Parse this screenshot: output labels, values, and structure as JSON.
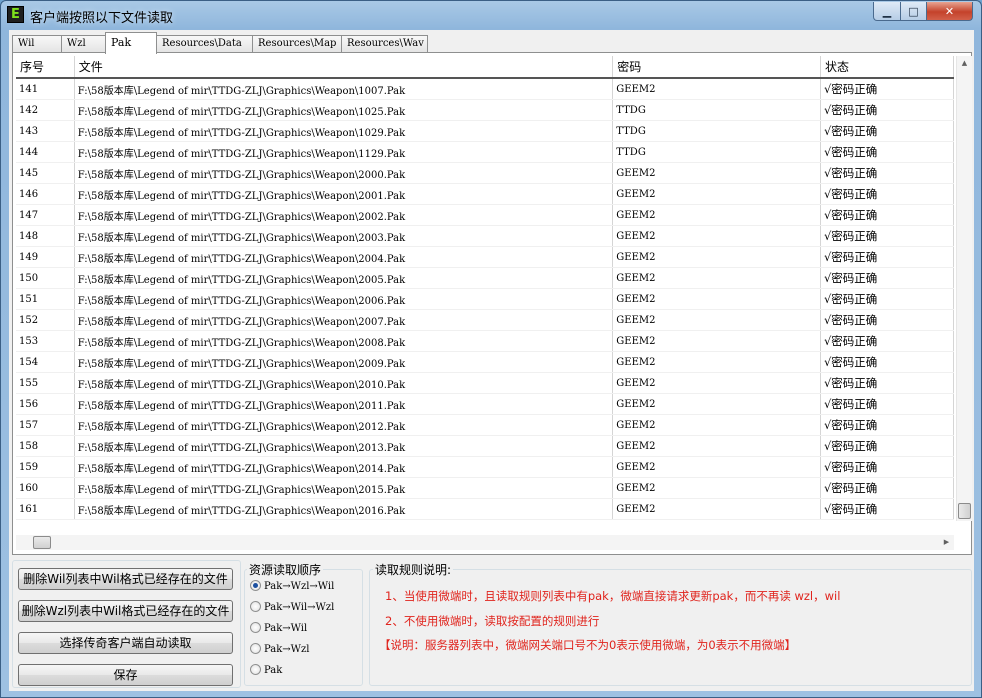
{
  "window": {
    "title": "客户端按照以下文件读取",
    "icon_letter": "E",
    "min_glyph": "▁",
    "max_glyph": "□",
    "close_glyph": "✕"
  },
  "tabs": [
    {
      "label": "Wil",
      "active": false
    },
    {
      "label": "Wzl",
      "active": false
    },
    {
      "label": "Pak",
      "active": true
    },
    {
      "label": "Resources\\Data",
      "active": false
    },
    {
      "label": "Resources\\Map",
      "active": false
    },
    {
      "label": "Resources\\Wav",
      "active": false
    }
  ],
  "table": {
    "columns": [
      "序号",
      "文件",
      "密码",
      "状态"
    ],
    "rows": [
      {
        "no": "141",
        "file": "F:\\58版本库\\Legend of mir\\TTDG-ZLJ\\Graphics\\Weapon\\1007.Pak",
        "password": "GEEM2",
        "status": "√密码正确"
      },
      {
        "no": "142",
        "file": "F:\\58版本库\\Legend of mir\\TTDG-ZLJ\\Graphics\\Weapon\\1025.Pak",
        "password": "TTDG",
        "status": "√密码正确"
      },
      {
        "no": "143",
        "file": "F:\\58版本库\\Legend of mir\\TTDG-ZLJ\\Graphics\\Weapon\\1029.Pak",
        "password": "TTDG",
        "status": "√密码正确"
      },
      {
        "no": "144",
        "file": "F:\\58版本库\\Legend of mir\\TTDG-ZLJ\\Graphics\\Weapon\\1129.Pak",
        "password": "TTDG",
        "status": "√密码正确"
      },
      {
        "no": "145",
        "file": "F:\\58版本库\\Legend of mir\\TTDG-ZLJ\\Graphics\\Weapon\\2000.Pak",
        "password": "GEEM2",
        "status": "√密码正确"
      },
      {
        "no": "146",
        "file": "F:\\58版本库\\Legend of mir\\TTDG-ZLJ\\Graphics\\Weapon\\2001.Pak",
        "password": "GEEM2",
        "status": "√密码正确"
      },
      {
        "no": "147",
        "file": "F:\\58版本库\\Legend of mir\\TTDG-ZLJ\\Graphics\\Weapon\\2002.Pak",
        "password": "GEEM2",
        "status": "√密码正确"
      },
      {
        "no": "148",
        "file": "F:\\58版本库\\Legend of mir\\TTDG-ZLJ\\Graphics\\Weapon\\2003.Pak",
        "password": "GEEM2",
        "status": "√密码正确"
      },
      {
        "no": "149",
        "file": "F:\\58版本库\\Legend of mir\\TTDG-ZLJ\\Graphics\\Weapon\\2004.Pak",
        "password": "GEEM2",
        "status": "√密码正确"
      },
      {
        "no": "150",
        "file": "F:\\58版本库\\Legend of mir\\TTDG-ZLJ\\Graphics\\Weapon\\2005.Pak",
        "password": "GEEM2",
        "status": "√密码正确"
      },
      {
        "no": "151",
        "file": "F:\\58版本库\\Legend of mir\\TTDG-ZLJ\\Graphics\\Weapon\\2006.Pak",
        "password": "GEEM2",
        "status": "√密码正确"
      },
      {
        "no": "152",
        "file": "F:\\58版本库\\Legend of mir\\TTDG-ZLJ\\Graphics\\Weapon\\2007.Pak",
        "password": "GEEM2",
        "status": "√密码正确"
      },
      {
        "no": "153",
        "file": "F:\\58版本库\\Legend of mir\\TTDG-ZLJ\\Graphics\\Weapon\\2008.Pak",
        "password": "GEEM2",
        "status": "√密码正确"
      },
      {
        "no": "154",
        "file": "F:\\58版本库\\Legend of mir\\TTDG-ZLJ\\Graphics\\Weapon\\2009.Pak",
        "password": "GEEM2",
        "status": "√密码正确"
      },
      {
        "no": "155",
        "file": "F:\\58版本库\\Legend of mir\\TTDG-ZLJ\\Graphics\\Weapon\\2010.Pak",
        "password": "GEEM2",
        "status": "√密码正确"
      },
      {
        "no": "156",
        "file": "F:\\58版本库\\Legend of mir\\TTDG-ZLJ\\Graphics\\Weapon\\2011.Pak",
        "password": "GEEM2",
        "status": "√密码正确"
      },
      {
        "no": "157",
        "file": "F:\\58版本库\\Legend of mir\\TTDG-ZLJ\\Graphics\\Weapon\\2012.Pak",
        "password": "GEEM2",
        "status": "√密码正确"
      },
      {
        "no": "158",
        "file": "F:\\58版本库\\Legend of mir\\TTDG-ZLJ\\Graphics\\Weapon\\2013.Pak",
        "password": "GEEM2",
        "status": "√密码正确"
      },
      {
        "no": "159",
        "file": "F:\\58版本库\\Legend of mir\\TTDG-ZLJ\\Graphics\\Weapon\\2014.Pak",
        "password": "GEEM2",
        "status": "√密码正确"
      },
      {
        "no": "160",
        "file": "F:\\58版本库\\Legend of mir\\TTDG-ZLJ\\Graphics\\Weapon\\2015.Pak",
        "password": "GEEM2",
        "status": "√密码正确"
      },
      {
        "no": "161",
        "file": "F:\\58版本库\\Legend of mir\\TTDG-ZLJ\\Graphics\\Weapon\\2016.Pak",
        "password": "GEEM2",
        "status": "√密码正确"
      }
    ]
  },
  "buttons": {
    "delete_wil": "删除Wil列表中Wil格式已经存在的文件",
    "delete_wzl": "删除Wzl列表中Wil格式已经存在的文件",
    "auto_read": "选择传奇客户端自动读取",
    "save": "保存"
  },
  "read_order": {
    "title": "资源读取顺序",
    "options": [
      {
        "label": "Pak→Wzl→Wil",
        "selected": true
      },
      {
        "label": "Pak→Wil→Wzl",
        "selected": false
      },
      {
        "label": "Pak→Wil",
        "selected": false
      },
      {
        "label": "Pak→Wzl",
        "selected": false
      },
      {
        "label": "Pak",
        "selected": false
      }
    ]
  },
  "rules": {
    "title": "读取规则说明:",
    "lines": [
      "1、当使用微端时，且读取规则列表中有pak，微端直接请求更新pak，而不再读 wzl，wil",
      "2、不使用微端时，读取按配置的规则进行",
      "【说明：服务器列表中，微端网关端口号不为0表示使用微端，为0表示不用微端】"
    ]
  },
  "scrollbar_glyphs": {
    "up": "▲",
    "down": "▼",
    "left": "◀",
    "right": "▶"
  },
  "colors": {
    "rule_text": "#e0241d",
    "radio_selected": "#1b4fa0"
  }
}
